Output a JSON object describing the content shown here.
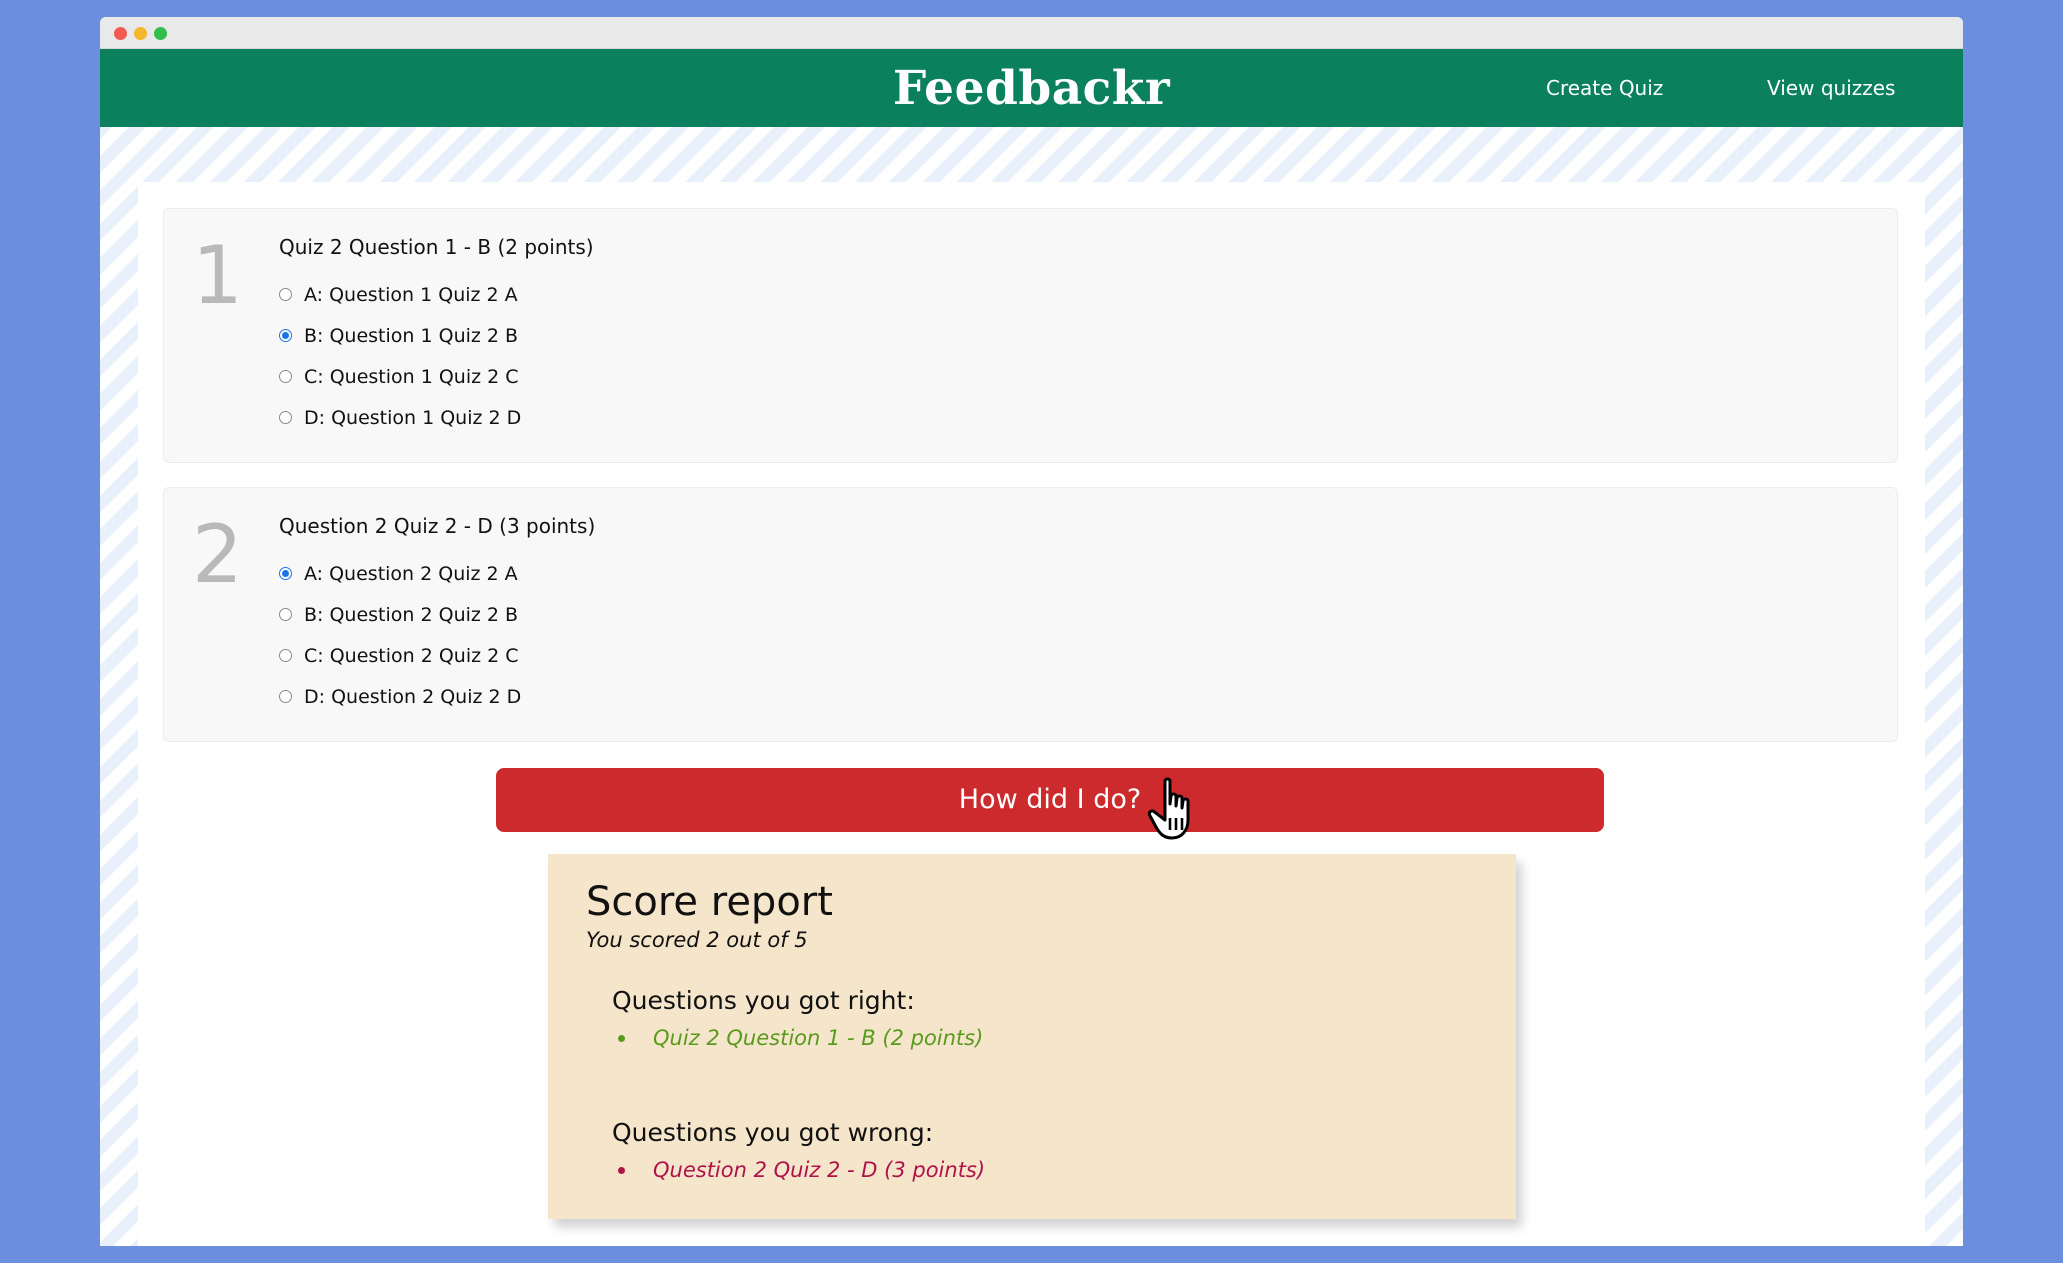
{
  "app": {
    "brand": "Feedbackr"
  },
  "nav": {
    "create_quiz": "Create Quiz",
    "view_quizzes": "View quizzes"
  },
  "questions": [
    {
      "number": "1",
      "title": "Quiz 2 Question 1 - B (2 points)",
      "options": [
        {
          "label": "A: Question 1 Quiz 2 A",
          "checked": false
        },
        {
          "label": "B: Question 1 Quiz 2 B",
          "checked": true
        },
        {
          "label": "C: Question 1 Quiz 2 C",
          "checked": false
        },
        {
          "label": "D: Question 1 Quiz 2 D",
          "checked": false
        }
      ]
    },
    {
      "number": "2",
      "title": "Question 2 Quiz 2 - D (3 points)",
      "options": [
        {
          "label": "A: Question 2 Quiz 2 A",
          "checked": true
        },
        {
          "label": "B: Question 2 Quiz 2 B",
          "checked": false
        },
        {
          "label": "C: Question 2 Quiz 2 C",
          "checked": false
        },
        {
          "label": "D: Question 2 Quiz 2 D",
          "checked": false
        }
      ]
    }
  ],
  "submit_label": "How did I do?",
  "score_report": {
    "title": "Score report",
    "subtitle": "You scored 2 out of 5",
    "right_heading": "Questions you got right:",
    "right_items": [
      "Quiz 2 Question 1 - B (2 points)"
    ],
    "wrong_heading": "Questions you got wrong:",
    "wrong_items": [
      "Question 2 Quiz 2 - D (3 points)"
    ]
  },
  "colors": {
    "navbar": "#0a805c",
    "submit_button": "#cc2a2c",
    "report_background": "#f5e5ca",
    "right_text": "#5a9a1e",
    "wrong_text": "#b0124a",
    "radio_selected": "#1a73e8"
  },
  "icons": {
    "cursor": "hand-pointer-icon"
  }
}
